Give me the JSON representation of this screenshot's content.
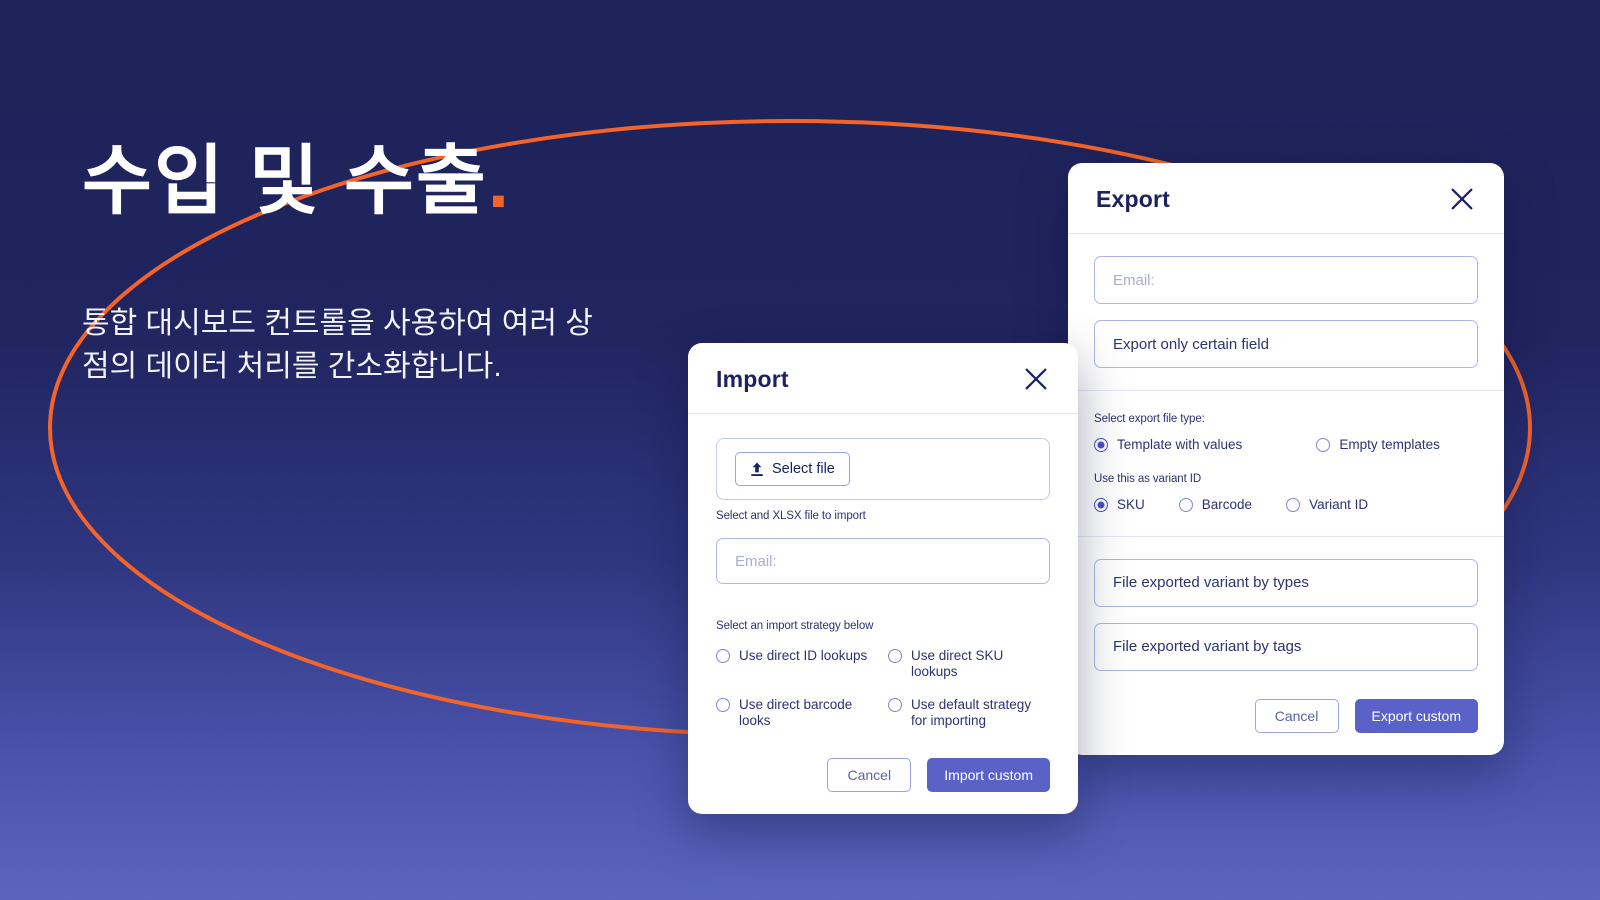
{
  "theme": {
    "bg_top": "#1e2258",
    "bg_bottom": "#5a65bd",
    "accent_orange": "#f4642a",
    "primary_indigo": "#5a62c8",
    "title_navy": "#1c2260"
  },
  "hero": {
    "title": "수입 및 수출",
    "title_dot": ".",
    "subtitle": "통합 대시보드 컨트롤을 사용하여 여러 상점의 데이터 처리를 간소화합니다."
  },
  "import_dialog": {
    "title": "Import",
    "close_icon": "close-icon",
    "select_file_button": "Select file",
    "upload_icon": "upload-icon",
    "helper_text": "Select and XLSX file to import",
    "email_placeholder": "Email:",
    "strategy_label": "Select an import strategy below",
    "strategy_options": [
      {
        "label": "Use direct ID lookups",
        "checked": false
      },
      {
        "label": "Use direct SKU lookups",
        "checked": false
      },
      {
        "label": "Use direct barcode looks",
        "checked": false
      },
      {
        "label": "Use default strategy for importing",
        "checked": false
      }
    ],
    "cancel_button": "Cancel",
    "submit_button": "Import custom"
  },
  "export_dialog": {
    "title": "Export",
    "close_icon": "close-icon",
    "email_placeholder": "Email:",
    "certain_field_value": "Export only certain field",
    "file_type_label": "Select export file type:",
    "file_type_options": [
      {
        "label": "Template with values",
        "checked": true
      },
      {
        "label": "Empty templates",
        "checked": false
      }
    ],
    "variant_id_label": "Use this as variant ID",
    "variant_id_options": [
      {
        "label": "SKU",
        "checked": true
      },
      {
        "label": "Barcode",
        "checked": false
      },
      {
        "label": "Variant ID",
        "checked": false
      }
    ],
    "variant_by_types_value": "File exported variant by types",
    "variant_by_tags_value": "File exported variant by tags",
    "cancel_button": "Cancel",
    "submit_button": "Export custom"
  }
}
